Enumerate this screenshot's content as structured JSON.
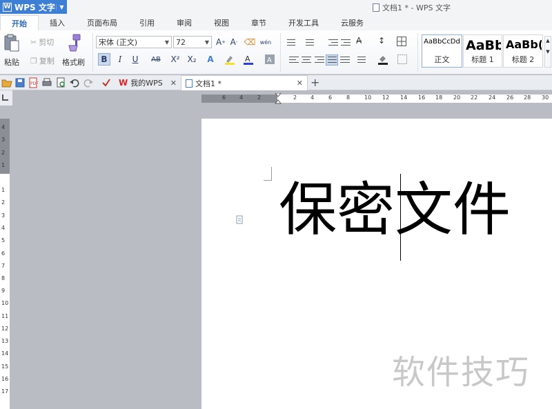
{
  "app": {
    "name": "WPS 文字",
    "window_title": "文档1 * - WPS 文字"
  },
  "ribbon_tabs": [
    "开始",
    "插入",
    "页面布局",
    "引用",
    "审阅",
    "视图",
    "章节",
    "开发工具",
    "云服务"
  ],
  "clipboard": {
    "paste": "粘贴",
    "cut": "剪切",
    "copy": "复制",
    "format_painter": "格式刷"
  },
  "font": {
    "family": "宋体 (正文)",
    "size": "72",
    "bold": "B",
    "italic": "I",
    "underline": "U",
    "strike": "AB",
    "superscript": "X²",
    "subscript": "X₂",
    "pinyin": "wén"
  },
  "styles": [
    {
      "sample": "AaBbCcDd",
      "label": "正文"
    },
    {
      "sample": "AaBb",
      "label": "标题 1"
    },
    {
      "sample": "AaBb(",
      "label": "标题 2"
    }
  ],
  "doc_tabs": [
    {
      "label": "我的WPS"
    },
    {
      "label": "文档1 *"
    }
  ],
  "hruler_ticks": [
    "6",
    "4",
    "2",
    "2",
    "4",
    "6",
    "8",
    "10",
    "12",
    "14",
    "16",
    "18",
    "20",
    "22",
    "24",
    "26",
    "28",
    "30"
  ],
  "vruler_ticks": [
    "4",
    "3",
    "2",
    "1",
    "1",
    "2",
    "3",
    "4",
    "5",
    "6",
    "7",
    "8",
    "9",
    "10",
    "11",
    "12",
    "13",
    "14",
    "15",
    "16",
    "17"
  ],
  "document": {
    "text_before_cursor": "保密",
    "text_after_cursor": "文件"
  },
  "watermark": "软件技巧",
  "colors": {
    "accent": "#3d7fd4",
    "tab_active_text": "#2b6cc4",
    "highlight": "#f5e02a",
    "font_color": "#2b3fd6",
    "wps_red": "#d9252b"
  }
}
